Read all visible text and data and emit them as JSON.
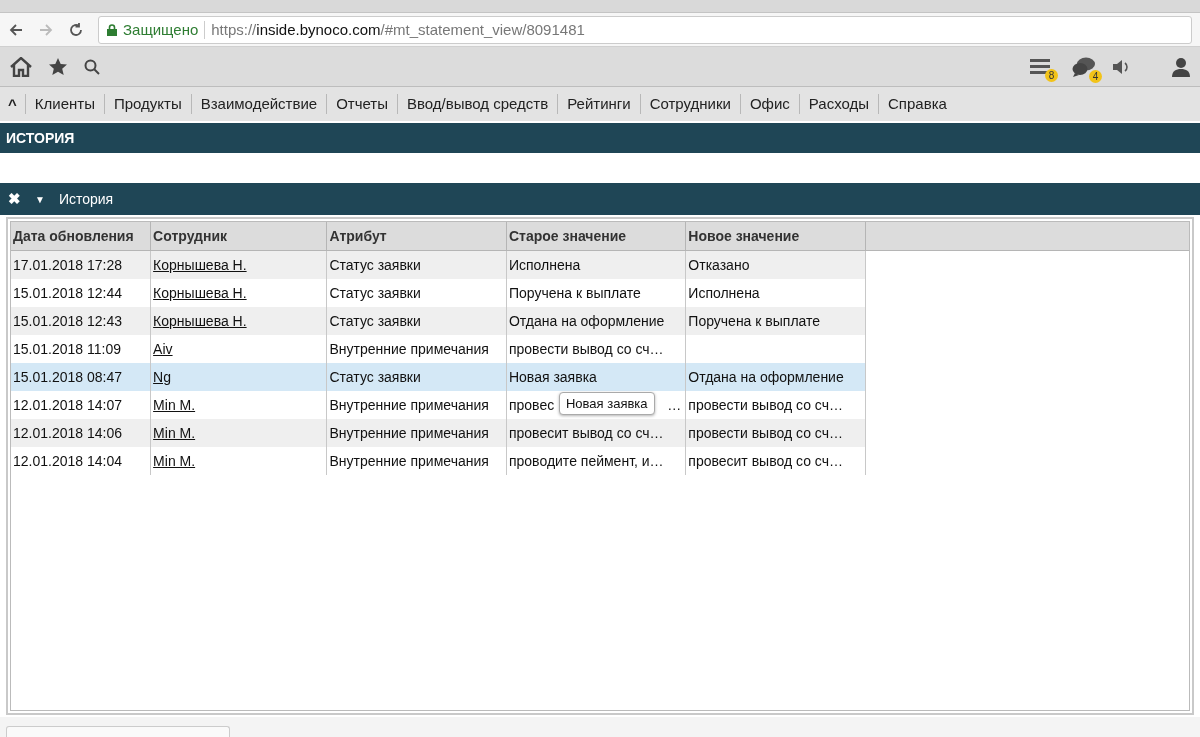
{
  "browser": {
    "secure_label": "Защищено",
    "url_scheme": "https://",
    "url_host": "inside.bynoco.com",
    "url_path": "/#mt_statement_view/8091481"
  },
  "toolbar": {
    "badges": [
      {
        "kind": "list",
        "count": "8"
      },
      {
        "kind": "chat",
        "count": "4"
      }
    ]
  },
  "menu": {
    "collapse": "^",
    "items": [
      "Клиенты",
      "Продукты",
      "Взаимодействие",
      "Отчеты",
      "Ввод/вывод средств",
      "Рейтинги",
      "Сотрудники",
      "Офис",
      "Расходы",
      "Справка"
    ]
  },
  "page_title": "ИСТОРИЯ",
  "panel": {
    "close": "✖",
    "toggle": "▼",
    "title": "История"
  },
  "table": {
    "columns": [
      "Дата обновления",
      "Сотрудник",
      "Атрибут",
      "Старое значение",
      "Новое значение"
    ],
    "rows": [
      {
        "date": "17.01.2018 17:28",
        "employee": "Корнышева Н.",
        "attribute": "Статус заявки",
        "old": "Исполнена",
        "new": "Отказано",
        "selected": false
      },
      {
        "date": "15.01.2018 12:44",
        "employee": "Корнышева Н.",
        "attribute": "Статус заявки",
        "old": "Поручена к выплате",
        "new": "Исполнена",
        "selected": false
      },
      {
        "date": "15.01.2018 12:43",
        "employee": "Корнышева Н.",
        "attribute": "Статус заявки",
        "old": "Отдана на оформление",
        "new": "Поручена к выплате",
        "selected": false
      },
      {
        "date": "15.01.2018 11:09",
        "employee": "Aiv",
        "attribute": "Внутренние примечания",
        "old": "провести вывод со сч…",
        "selected": false
      },
      {
        "date": "15.01.2018 08:47",
        "employee": "Ng",
        "attribute": "Статус заявки",
        "old": "Новая заявка",
        "new": "Отдана на оформление",
        "selected": true
      },
      {
        "date": "12.01.2018 14:07",
        "employee": "Min M.",
        "attribute": "Внутренние примечания",
        "old": "провес",
        "tooltip": "Новая заявка",
        "old_tail": "…",
        "new": "провести вывод со сч…",
        "selected": false
      },
      {
        "date": "12.01.2018 14:06",
        "employee": "Min M.",
        "attribute": "Внутренние примечания",
        "old": "провесит вывод со сч…",
        "new": "провести вывод со сч…",
        "selected": false
      },
      {
        "date": "12.01.2018 14:04",
        "employee": "Min M.",
        "attribute": "Внутренние примечания",
        "old": "проводите пеймент, и…",
        "new": "провесит вывод со сч…",
        "selected": false
      }
    ]
  }
}
